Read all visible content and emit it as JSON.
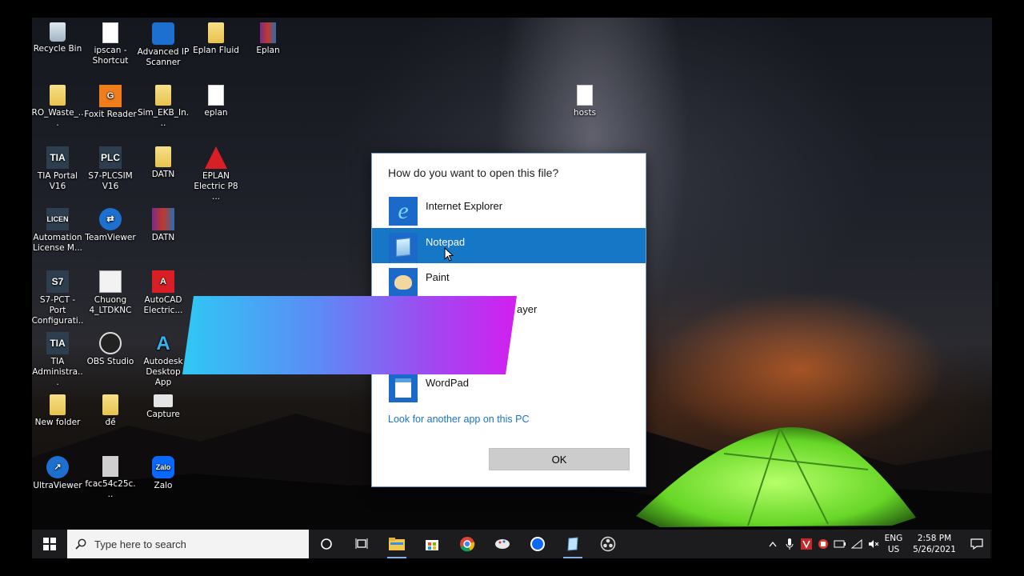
{
  "desktop": {
    "icons": [
      {
        "label": "Recycle Bin",
        "icon": "recycle-bin-icon"
      },
      {
        "label": "ipscan - Shortcut",
        "icon": "ipscan-icon"
      },
      {
        "label": "Advanced IP Scanner",
        "icon": "ip-scanner-icon"
      },
      {
        "label": "Eplan  Fluid",
        "icon": "folder-icon"
      },
      {
        "label": "Eplan",
        "icon": "eplan-icon"
      },
      {
        "label": "RO_Waste_...",
        "icon": "tia-file-icon"
      },
      {
        "label": "Foxit Reader",
        "icon": "foxit-icon"
      },
      {
        "label": "Sim_EKB_In...",
        "icon": "folder-icon"
      },
      {
        "label": "eplan",
        "icon": "file-icon"
      },
      {
        "label": "hosts",
        "icon": "file-icon"
      },
      {
        "label": "TIA Portal V16",
        "icon": "tia-portal-icon",
        "glyph": "TIA"
      },
      {
        "label": "S7-PLCSIM V16",
        "icon": "plcsim-icon",
        "glyph": "PLC"
      },
      {
        "label": "DATN",
        "icon": "folder-icon"
      },
      {
        "label": "EPLAN Electric P8 ...",
        "icon": "eplan-electric-icon"
      },
      {
        "label": "Automation License M...",
        "icon": "license-manager-icon",
        "glyph": "LICEN"
      },
      {
        "label": "TeamViewer",
        "icon": "teamviewer-icon"
      },
      {
        "label": "DATN",
        "icon": "winrar-icon"
      },
      {
        "label": "S7-PCT - Port Configurati...",
        "icon": "s7-pct-icon",
        "glyph": "S7"
      },
      {
        "label": "Chuong 4_LTDKNC",
        "icon": "document-icon"
      },
      {
        "label": "AutoCAD Electric...",
        "icon": "autocad-icon",
        "glyph": "A"
      },
      {
        "label": "TIA Administra...",
        "icon": "tia-admin-icon",
        "glyph": "TIA"
      },
      {
        "label": "OBS Studio",
        "icon": "obs-icon"
      },
      {
        "label": "Autodesk Desktop App",
        "icon": "autodesk-icon",
        "glyph": "A"
      },
      {
        "label": "New folder",
        "icon": "folder-icon"
      },
      {
        "label": "đề",
        "icon": "folder-icon"
      },
      {
        "label": "Capture",
        "icon": "image-icon"
      },
      {
        "label": "UltraViewer",
        "icon": "ultraviewer-icon"
      },
      {
        "label": "fcac54c25c...",
        "icon": "file-icon"
      },
      {
        "label": "Zalo",
        "icon": "zalo-icon",
        "glyph": "Zalo"
      }
    ]
  },
  "dialog": {
    "title": "How do you want to open this file?",
    "apps": [
      {
        "name": "Internet Explorer",
        "icon": "internet-explorer-icon",
        "selected": false
      },
      {
        "name": "Notepad",
        "icon": "notepad-icon",
        "selected": true
      },
      {
        "name": "Paint",
        "icon": "paint-icon",
        "selected": false
      },
      {
        "name": "WordPad",
        "icon": "wordpad-icon",
        "selected": false
      }
    ],
    "partial_text": "ayer",
    "more_link": "Look for another app on this PC",
    "ok_label": "OK"
  },
  "taskbar": {
    "search_placeholder": "Type here to search",
    "pinned": [
      "cortana-icon",
      "task-view-icon",
      "file-explorer-icon",
      "store-icon",
      "chrome-icon",
      "paint-3d-icon",
      "zalo-icon",
      "notepad-icon",
      "obs-icon"
    ],
    "tray": {
      "lang_line1": "ENG",
      "lang_line2": "US",
      "time": "2:58 PM",
      "date": "5/26/2021"
    }
  },
  "colors": {
    "selection": "#1777c7",
    "link": "#1a73c9",
    "banner_start": "#2fc8f4",
    "banner_end": "#d21ff0",
    "tent": "#7cf23a"
  }
}
